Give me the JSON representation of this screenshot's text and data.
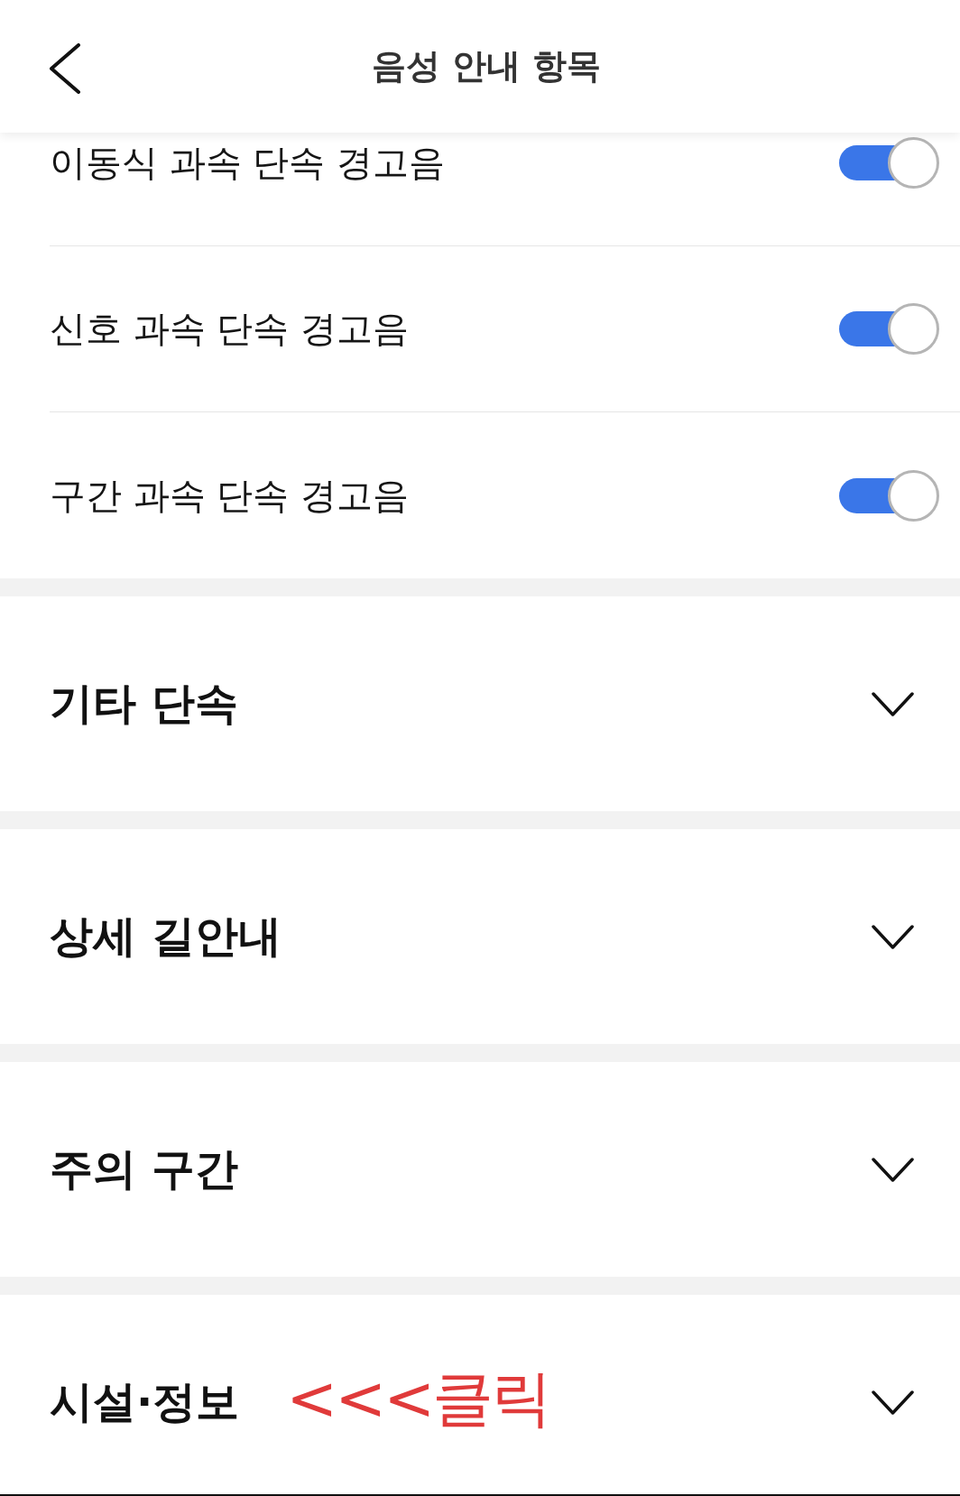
{
  "header": {
    "title": "음성 안내 항목"
  },
  "toggles": [
    {
      "label": "이동식 과속 단속 경고음",
      "on": true
    },
    {
      "label": "신호 과속 단속 경고음",
      "on": true
    },
    {
      "label": "구간 과속 단속 경고음",
      "on": true
    }
  ],
  "sections": [
    {
      "title": "기타 단속",
      "expanded": false
    },
    {
      "title": "상세 길안내",
      "expanded": false
    },
    {
      "title": "주의 구간",
      "expanded": false
    },
    {
      "title": "시설·정보",
      "expanded": false,
      "annotation": "<<<클릭"
    }
  ]
}
